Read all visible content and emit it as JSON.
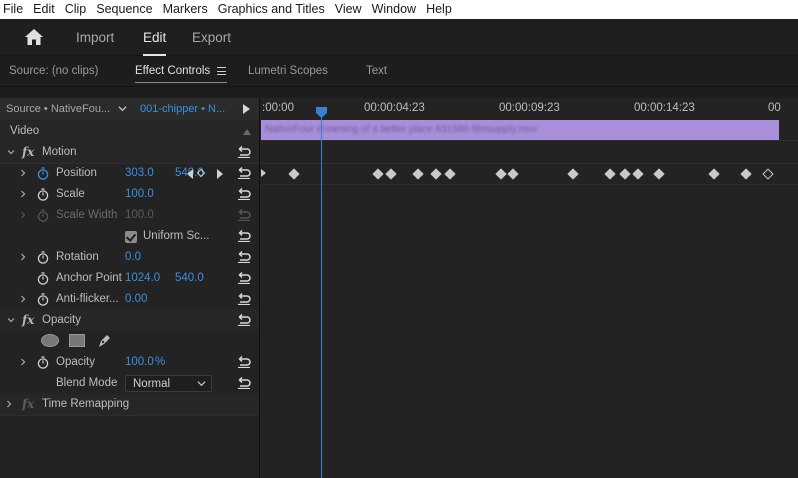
{
  "menubar": {
    "items": [
      "File",
      "Edit",
      "Clip",
      "Sequence",
      "Markers",
      "Graphics and Titles",
      "View",
      "Window",
      "Help"
    ]
  },
  "workspace": {
    "home_icon": "home-icon",
    "tabs": [
      {
        "label": "Import",
        "active": false
      },
      {
        "label": "Edit",
        "active": true
      },
      {
        "label": "Export",
        "active": false
      }
    ]
  },
  "panels": {
    "tabs": [
      {
        "label": "Source: (no clips)",
        "active": false
      },
      {
        "label": "Effect Controls",
        "active": true
      },
      {
        "label": "Lumetri Scopes",
        "active": false
      },
      {
        "label": "Text",
        "active": false
      }
    ],
    "menu_icon": "panel-menu-icon"
  },
  "effect_controls": {
    "source_label": "Source • NativeFou...",
    "sequence_label": "001-chipper • N...",
    "video_header": "Video",
    "motion": {
      "name": "Motion",
      "position": {
        "label": "Position",
        "x": "303.0",
        "y": "540.0"
      },
      "scale": {
        "label": "Scale",
        "value": "100.0"
      },
      "scale_width": {
        "label": "Scale Width",
        "value": "100.0"
      },
      "uniform_scale": {
        "label": "Uniform Sc...",
        "checked": true
      },
      "rotation": {
        "label": "Rotation",
        "value": "0.0"
      },
      "anchor_point": {
        "label": "Anchor Point",
        "x": "1024.0",
        "y": "540.0"
      },
      "anti_flicker": {
        "label": "Anti-flicker...",
        "value": "0.00"
      }
    },
    "opacity": {
      "name": "Opacity",
      "opacity": {
        "label": "Opacity",
        "value": "100.0",
        "unit": "%"
      },
      "blend_mode": {
        "label": "Blend Mode",
        "value": "Normal"
      }
    },
    "time_remapping": {
      "name": "Time Remapping"
    }
  },
  "timeline": {
    "timecodes": [
      ":00:00",
      "00:00:04:23",
      "00:00:09:23",
      "00:00:14:23",
      "00"
    ],
    "clip_name": "NativeFour dreaming of a better place 631586 filmsupply.mov",
    "accent_color": "#3a7fd0",
    "clip_color": "#a98fdb"
  }
}
